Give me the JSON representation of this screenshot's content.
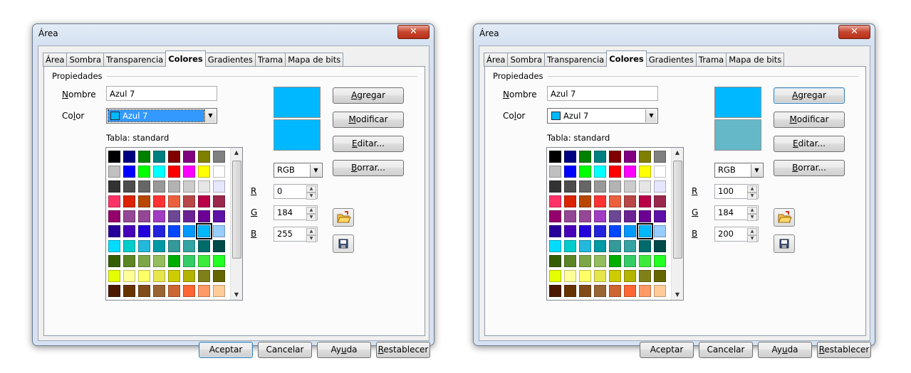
{
  "palette_colors": [
    "#000000",
    "#000080",
    "#008000",
    "#008080",
    "#800000",
    "#800080",
    "#808000",
    "#808080",
    "#c0c0c0",
    "#0000ff",
    "#00ff00",
    "#00ffff",
    "#ff0000",
    "#ff00ff",
    "#ffff00",
    "#ffffff",
    "#333333",
    "#4d4d4d",
    "#666666",
    "#999999",
    "#b3b3b3",
    "#cccccc",
    "#e6e6e6",
    "#e6e6ff",
    "#ff3366",
    "#dc2300",
    "#b84700",
    "#ff3333",
    "#eb613d",
    "#b84747",
    "#b80047",
    "#99284c",
    "#94006b",
    "#944794",
    "#944794",
    "#a13dc2",
    "#6b4794",
    "#6b2394",
    "#6b0094",
    "#5e11a6",
    "#280099",
    "#4700b8",
    "#2300dc",
    "#2323dc",
    "#0047ff",
    "#0099ff",
    "#00b8ff",
    "#99ccff",
    "#00dcff",
    "#00cccc",
    "#23b8dc",
    "#0099a6",
    "#339999",
    "#33a3a3",
    "#006b6b",
    "#004a4a",
    "#355e00",
    "#5c8526",
    "#7da647",
    "#94bd5e",
    "#00ae00",
    "#33cc66",
    "#3deb3d",
    "#23ff23",
    "#e6ff00",
    "#ffff99",
    "#ffff66",
    "#e6e64c",
    "#cccc00",
    "#b3b300",
    "#808019",
    "#666600",
    "#4c1900",
    "#663300",
    "#804c19",
    "#996633",
    "#cc6633",
    "#ff6633",
    "#ff9966",
    "#ffcc99"
  ],
  "dialogs": [
    {
      "title": "Área",
      "close": "✕",
      "tabs": [
        "Área",
        "Sombra",
        "Transparencia",
        "Colores",
        "Gradientes",
        "Trama",
        "Mapa de bits"
      ],
      "active_tab": "Colores",
      "group": "Propiedades",
      "name_label": "Nombre",
      "name_value": "Azul 7",
      "color_label": "Color",
      "color_value": "Azul 7",
      "color_swatch": "#00b8ff",
      "table_label": "Tabla: standard",
      "selected_index": 46,
      "preview_top": "#00b8ff",
      "preview_bottom": "#00b8ff",
      "mode": "RGB",
      "r_label": "R",
      "g_label": "G",
      "b_label": "B",
      "r": "0",
      "g": "184",
      "b": "255",
      "buttons": [
        "Agregar",
        "Modificar",
        "Editar...",
        "Borrar..."
      ],
      "footer": [
        "Aceptar",
        "Cancelar",
        "Ayuda",
        "Restablecer"
      ],
      "icons": [
        "open-palette-icon",
        "save-palette-icon"
      ]
    },
    {
      "title": "Área",
      "close": "✕",
      "tabs": [
        "Área",
        "Sombra",
        "Transparencia",
        "Colores",
        "Gradientes",
        "Trama",
        "Mapa de bits"
      ],
      "active_tab": "Colores",
      "group": "Propiedades",
      "name_label": "Nombre",
      "name_value": "Azul 7",
      "color_label": "Color",
      "color_value": "Azul 7",
      "color_swatch": "#00b8ff",
      "table_label": "Tabla: standard",
      "selected_index": 46,
      "preview_top": "#00b8ff",
      "preview_bottom": "#64b8c8",
      "mode": "RGB",
      "r_label": "R",
      "g_label": "G",
      "b_label": "B",
      "r": "100",
      "g": "184",
      "b": "200",
      "buttons": [
        "Agregar",
        "Modificar",
        "Editar...",
        "Borrar..."
      ],
      "footer": [
        "Aceptar",
        "Cancelar",
        "Ayuda",
        "Restablecer"
      ],
      "icons": [
        "open-palette-icon",
        "save-palette-icon"
      ]
    }
  ]
}
